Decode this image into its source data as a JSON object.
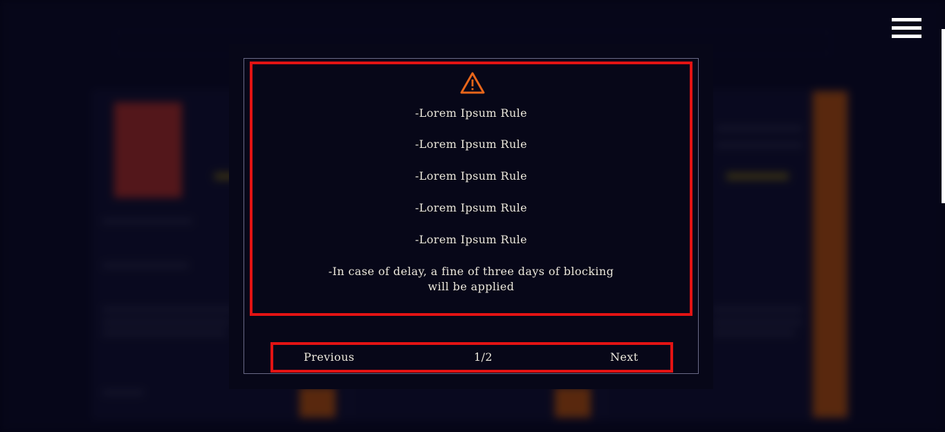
{
  "menu": {
    "icon": "hamburger-menu-icon"
  },
  "modal": {
    "warning_icon": "warning-triangle-icon",
    "warning_color": "#e8661a",
    "border_color": "#e31313",
    "rules": [
      "-Lorem Ipsum Rule",
      "-Lorem Ipsum Rule",
      "-Lorem Ipsum Rule",
      "-Lorem Ipsum Rule",
      "-Lorem Ipsum Rule"
    ],
    "delay_rule": "-In case of delay, a fine of three days of blocking will be applied",
    "pagination": {
      "previous_label": "Previous",
      "page_indicator": "1/2",
      "next_label": "Next"
    }
  }
}
